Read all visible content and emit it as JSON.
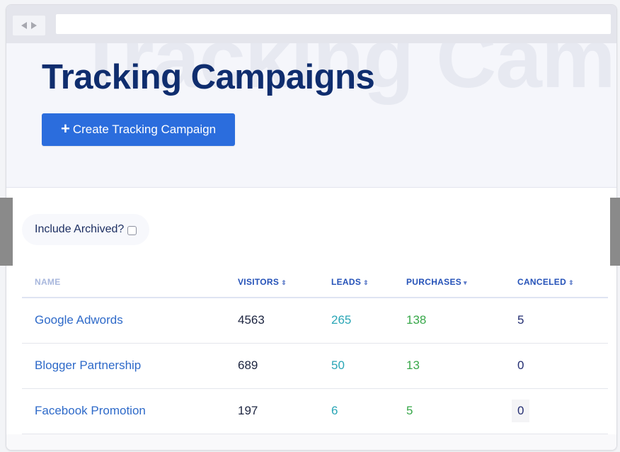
{
  "browser": {
    "back_icon": "triangle-left-icon",
    "forward_icon": "triangle-right-icon",
    "url": ""
  },
  "header": {
    "watermark": "Tracking Campaigns",
    "title": "Tracking Campaigns",
    "create_button": {
      "icon": "plus-icon",
      "icon_glyph": "+",
      "label": "Create Tracking Campaign",
      "color": "#2b6ddd"
    }
  },
  "filters": {
    "include_archived_label": "Include Archived?",
    "include_archived_checked": false
  },
  "table": {
    "columns": [
      {
        "key": "name",
        "label": "NAME",
        "sort_glyph": ""
      },
      {
        "key": "visitors",
        "label": "VISITORS",
        "sort_glyph": "⇕",
        "sort_icon": "sort-both-icon"
      },
      {
        "key": "leads",
        "label": "LEADS",
        "sort_glyph": "⇕",
        "sort_icon": "sort-both-icon"
      },
      {
        "key": "purchases",
        "label": "PURCHASES",
        "sort_glyph": "▾",
        "sort_icon": "sort-desc-icon"
      },
      {
        "key": "canceled",
        "label": "CANCELED",
        "sort_glyph": "⇕",
        "sort_icon": "sort-both-icon"
      }
    ],
    "rows": [
      {
        "name": "Google Adwords",
        "visitors": "4563",
        "leads": "265",
        "purchases": "138",
        "canceled": "5"
      },
      {
        "name": "Blogger Partnership",
        "visitors": "689",
        "leads": "50",
        "purchases": "13",
        "canceled": "0"
      },
      {
        "name": "Facebook Promotion",
        "visitors": "197",
        "leads": "6",
        "purchases": "5",
        "canceled": "0"
      }
    ],
    "colors": {
      "name": "#2e6ac9",
      "visitors": "#1d2540",
      "leads": "#2aa6b6",
      "purchases": "#38a84a",
      "canceled": "#252f72"
    }
  }
}
